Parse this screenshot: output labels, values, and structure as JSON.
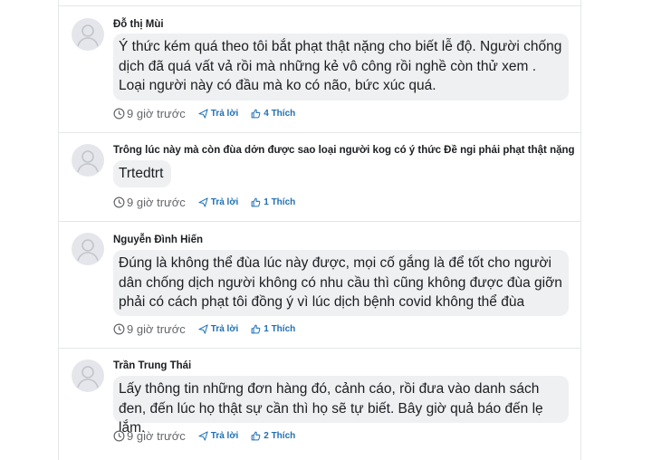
{
  "comments": [
    {
      "author": "Đỗ thị Mùi",
      "text": "Ý thức kém quá theo tôi bắt phạt thật nặng cho biết lễ độ. Người chống dịch đã quá vất vả rồi mà những kẻ vô công rồi nghề còn thử xem . Loại người này có đầu mà ko có não, bức xúc quá.",
      "time": "9 giờ trước",
      "reply_label": "Trả lời",
      "like_label": "4 Thích"
    },
    {
      "author": "Trông lúc này mà còn đùa dởn được sao loại người kog có ý thức Đề ngi phải phạt thật nặng",
      "text": "Trtedtrt",
      "time": "9 giờ trước",
      "reply_label": "Trả lời",
      "like_label": "1 Thích"
    },
    {
      "author": "Nguyễn Đình Hiến",
      "text": "Đúng là không thể đùa lúc này được, mọi cố gắng là để tốt cho người dân chống dịch người không có nhu cầu thì cũng không được đùa giỡn phải có cách phạt tôi đồng ý vì lúc dịch bệnh covid không thể đùa",
      "time": "9 giờ trước",
      "reply_label": "Trả lời",
      "like_label": "1 Thích"
    },
    {
      "author": "Trần Trung Thái",
      "text": "Lấy thông tin những đơn hàng đó, cảnh cáo, rồi đưa vào danh sách đen, đến lúc họ thật sự cần thì họ sẽ tự biết. Bây giờ quả báo đến lẹ lắm.",
      "time": "9 giờ trước",
      "reply_label": "Trả lời",
      "like_label": "2 Thích"
    }
  ],
  "icons": {
    "avatar": "user-silhouette-icon",
    "time": "clock-icon",
    "reply": "paper-plane-icon",
    "like": "thumbs-up-icon"
  },
  "colors": {
    "accent": "#1f6fb5",
    "bubble": "#eef0f2",
    "muted": "#65676b",
    "separator": "#e4e6eb"
  }
}
